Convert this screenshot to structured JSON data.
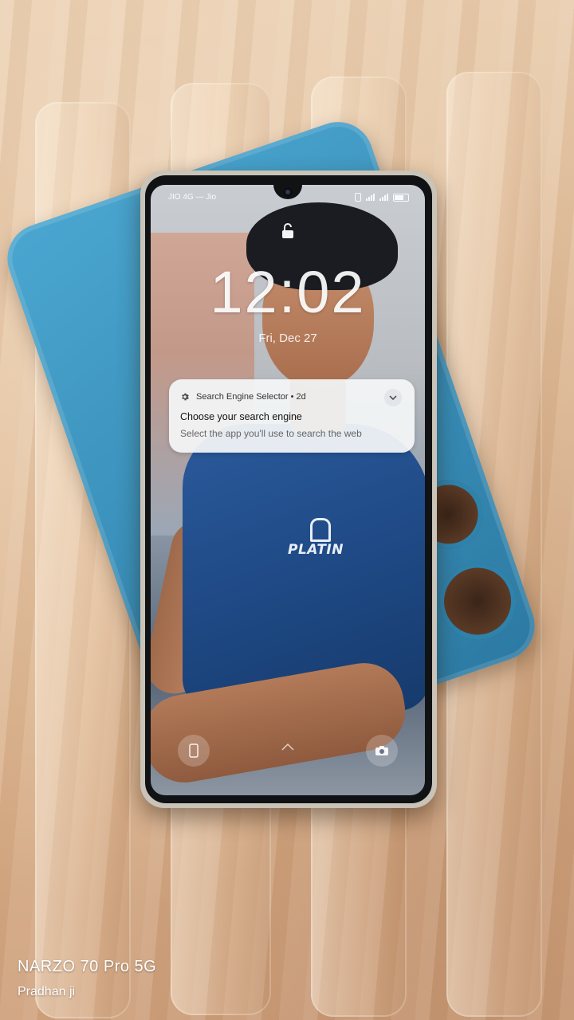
{
  "lockscreen": {
    "carrier": "JIO 4G — Jio",
    "time": "12:02",
    "date": "Fri, Dec 27"
  },
  "notification": {
    "app_name": "Search Engine Selector • 2d",
    "title": "Choose your search engine",
    "body": "Select the app you'll use to search the web",
    "icon": "gear-icon"
  },
  "shirt_print": "PLATIN",
  "photo_watermark": {
    "model": "NARZO 70 Pro 5G",
    "author": "Pradhan ji"
  },
  "colors": {
    "case": "#3a90ba",
    "shirt": "#1f4a86",
    "surface": "#e2bf9c"
  }
}
